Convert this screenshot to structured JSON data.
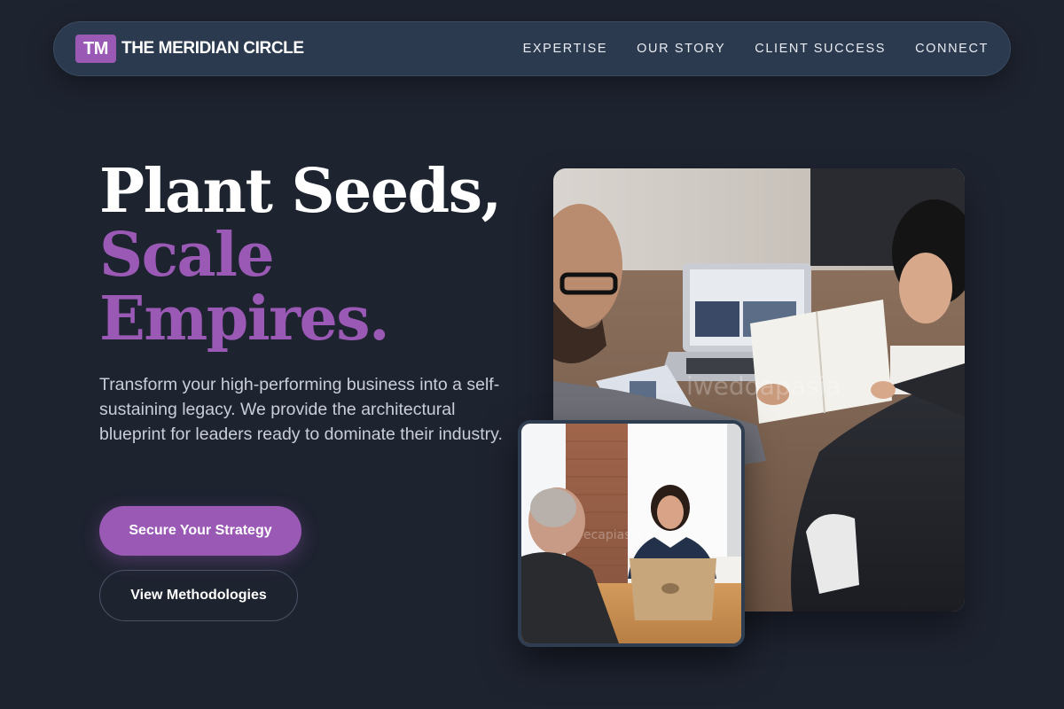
{
  "nav": {
    "logo_mark": "TM",
    "brand_name": "THE MERIDIAN CIRCLE",
    "links": [
      "EXPERTISE",
      "OUR STORY",
      "CLIENT SUCCESS",
      "CONNECT"
    ]
  },
  "hero": {
    "title_line1": "Plant Seeds,",
    "title_line2": "Scale",
    "title_line3": "Empires.",
    "description": "Transform your high-performing business into a self-sustaining legacy. We provide the architectural blueprint for leaders ready to dominate their industry.",
    "primary_cta": "Secure Your Strategy",
    "secondary_cta": "View Methodologies"
  },
  "colors": {
    "background": "#1e2330",
    "accent": "#9b59b6",
    "nav_bg": "#2b3a4e"
  },
  "images": {
    "main": "business-meeting-photo",
    "secondary": "interview-meeting-photo"
  }
}
